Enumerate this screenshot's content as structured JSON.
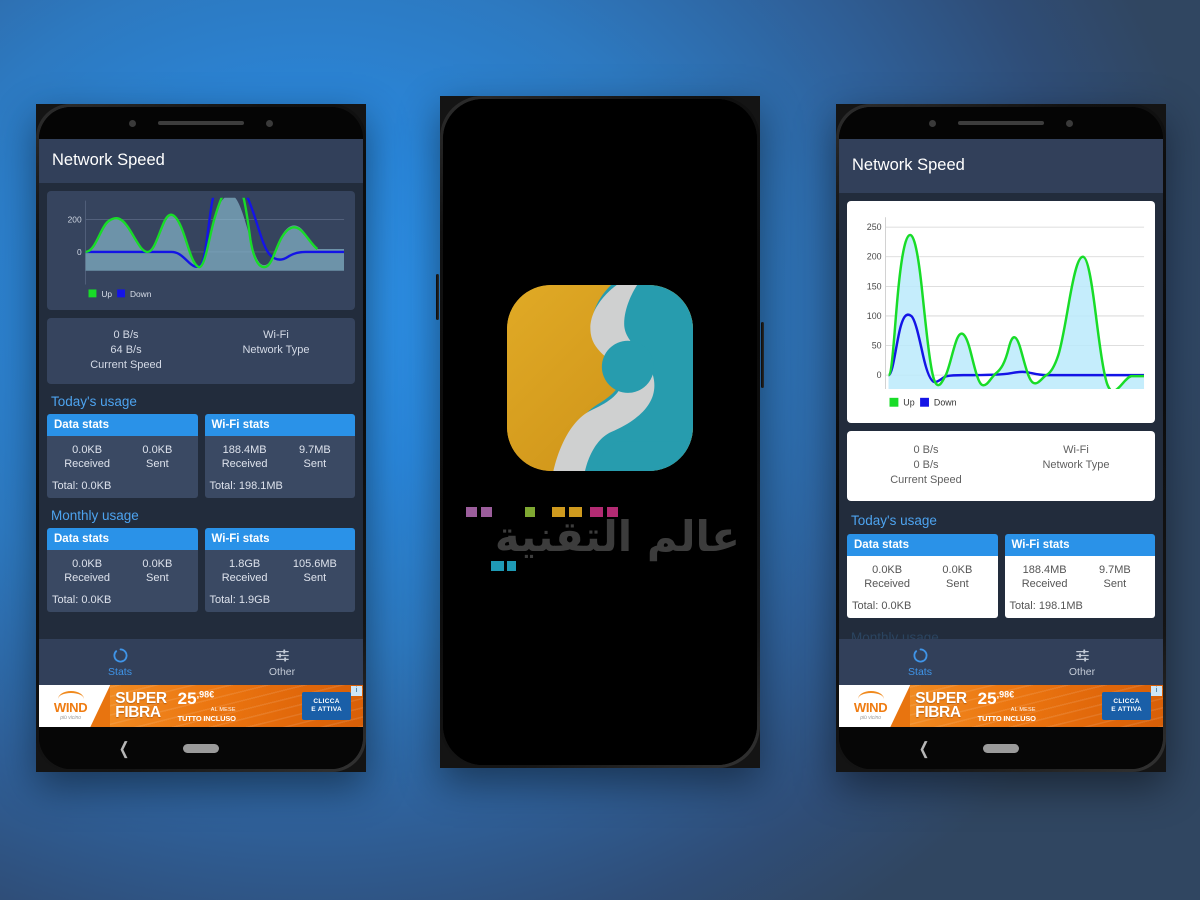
{
  "background": {
    "accent": "#2a92e8",
    "dark_panel": "#222c3c",
    "bar": "#32405a"
  },
  "app": {
    "title": "Network Speed",
    "chart": {
      "legend": [
        {
          "label": "Up",
          "color": "#18dc28"
        },
        {
          "label": "Down",
          "color": "#1414e6"
        }
      ]
    },
    "speed": {
      "up_value": "0 B/s",
      "down_value_left": "64 B/s",
      "down_value_right": "0 B/s",
      "speed_label": "Current Speed",
      "network_value": "Wi-Fi",
      "network_label": "Network Type"
    },
    "sections": {
      "today": "Today's usage",
      "monthly": "Monthly usage"
    },
    "labels": {
      "received": "Received",
      "sent": "Sent",
      "data_stats": "Data stats",
      "wifi_stats": "Wi-Fi stats"
    },
    "today": {
      "data": {
        "title": "Data stats",
        "received": "0.0KB",
        "sent": "0.0KB",
        "total": "Total: 0.0KB"
      },
      "wifi": {
        "title": "Wi-Fi stats",
        "received": "188.4MB",
        "sent": "9.7MB",
        "total": "Total: 198.1MB"
      }
    },
    "monthly": {
      "data": {
        "title": "Data stats",
        "received": "0.0KB",
        "sent": "0.0KB",
        "total": "Total: 0.0KB"
      },
      "wifi": {
        "title": "Wi-Fi stats",
        "received": "1.8GB",
        "sent": "105.6MB",
        "total": "Total: 1.9GB"
      }
    },
    "tabs": [
      {
        "label": "Stats",
        "icon": "donut-chart-icon",
        "active": true
      },
      {
        "label": "Other",
        "icon": "tune-sliders-icon",
        "active": false
      }
    ]
  },
  "ad": {
    "brand": "WIND",
    "brand_tagline": "più vicino",
    "title_line1": "SUPER",
    "title_line2": "FIBRA",
    "price_num": "25",
    "price_cents": ",98€",
    "price_period": "AL MESE",
    "price_included": "TUTTO INCLUSO",
    "cta_line1": "CLICCA",
    "cta_line2": "E ATTIVA",
    "info_badge": "i"
  },
  "splash": {
    "watermark_text": "عالم التقنية",
    "icon_colors": {
      "gold": "#d79f21",
      "teal": "#269eb0",
      "grey": "#cfd0d0"
    }
  },
  "chart_data": [
    {
      "id": "left-phone-chart",
      "type": "line",
      "theme": "dark",
      "title": "",
      "xlabel": "",
      "ylabel": "",
      "ylim": [
        -120,
        320
      ],
      "yticks": [
        0,
        200
      ],
      "ytick_labels": [
        "0",
        "200"
      ],
      "grid": true,
      "legend_position": "bottom-left",
      "series": [
        {
          "name": "Up",
          "color": "#18dc28",
          "x": [
            0,
            4,
            8,
            12,
            16,
            20,
            24,
            28,
            32,
            36,
            40,
            44,
            48,
            52,
            56,
            60,
            64,
            68,
            72,
            76,
            80,
            84,
            88,
            92,
            96,
            100
          ],
          "values": [
            0,
            60,
            150,
            208,
            215,
            190,
            120,
            40,
            0,
            80,
            200,
            248,
            215,
            110,
            10,
            -60,
            -85,
            -30,
            180,
            300,
            320,
            280,
            60,
            -70,
            -40,
            60
          ]
        },
        {
          "name": "Down",
          "color": "#1414e6",
          "x": [
            0,
            4,
            8,
            12,
            16,
            20,
            24,
            28,
            32,
            36,
            40,
            44,
            48,
            52,
            56,
            60,
            64,
            68,
            72,
            76,
            80,
            84,
            88,
            92,
            96,
            100
          ],
          "values": [
            0,
            0,
            0,
            0,
            0,
            0,
            0,
            0,
            0,
            -5,
            -30,
            -80,
            -95,
            -30,
            140,
            320,
            330,
            300,
            200,
            120,
            40,
            -20,
            -48,
            -35,
            0,
            0
          ]
        }
      ]
    },
    {
      "id": "right-phone-chart",
      "type": "line",
      "theme": "light",
      "title": "",
      "xlabel": "",
      "ylabel": "",
      "ylim": [
        -30,
        260
      ],
      "yticks": [
        0,
        50,
        100,
        150,
        200,
        250
      ],
      "ytick_labels": [
        "0",
        "50",
        "100",
        "150",
        "200",
        "250"
      ],
      "grid": true,
      "legend_position": "bottom-left",
      "series": [
        {
          "name": "Up",
          "color": "#18dc28",
          "x": [
            0,
            4,
            8,
            12,
            16,
            20,
            24,
            28,
            32,
            36,
            40,
            44,
            48,
            52,
            56,
            60,
            64,
            68,
            72,
            76,
            80,
            84,
            88,
            92,
            96,
            100
          ],
          "values": [
            0,
            120,
            233,
            190,
            60,
            -10,
            20,
            63,
            35,
            -12,
            -5,
            10,
            40,
            63,
            45,
            5,
            -8,
            0,
            40,
            130,
            202,
            150,
            40,
            -20,
            -10,
            0
          ]
        },
        {
          "name": "Down",
          "color": "#1414e6",
          "x": [
            0,
            4,
            8,
            12,
            16,
            20,
            24,
            28,
            32,
            36,
            40,
            44,
            48,
            52,
            56,
            60,
            64,
            68,
            72,
            76,
            80,
            84,
            88,
            92,
            96,
            100
          ],
          "values": [
            0,
            62,
            104,
            70,
            10,
            -11,
            -2,
            0,
            0,
            0,
            0,
            0,
            1,
            3,
            3,
            1,
            0,
            0,
            0,
            0,
            0,
            0,
            0,
            0,
            0,
            0
          ]
        }
      ]
    }
  ]
}
